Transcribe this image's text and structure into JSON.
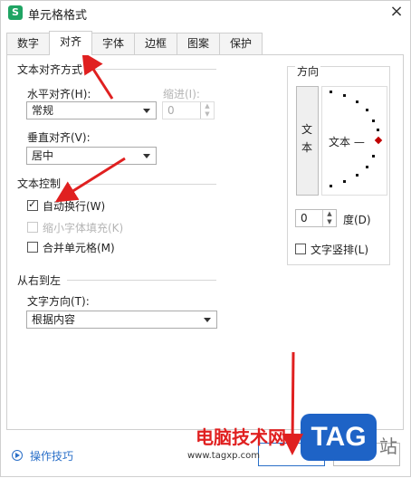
{
  "window": {
    "title": "单元格格式",
    "app_icon_letter": "S",
    "close_glyph": "×"
  },
  "tabs": [
    {
      "label": "数字",
      "active": false
    },
    {
      "label": "对齐",
      "active": true
    },
    {
      "label": "字体",
      "active": false
    },
    {
      "label": "边框",
      "active": false
    },
    {
      "label": "图案",
      "active": false
    },
    {
      "label": "保护",
      "active": false
    }
  ],
  "alignment": {
    "section_title": "文本对齐方式",
    "horizontal_label": "水平对齐(H):",
    "horizontal_value": "常规",
    "indent_label": "缩进(I):",
    "indent_value": "0",
    "vertical_label": "垂直对齐(V):",
    "vertical_value": "居中"
  },
  "text_control": {
    "section_title": "文本控制",
    "wrap_text": {
      "label": "自动换行(W)",
      "checked": true,
      "disabled": false
    },
    "shrink_to_fit": {
      "label": "缩小字体填充(K)",
      "checked": false,
      "disabled": true
    },
    "merge_cells": {
      "label": "合并单元格(M)",
      "checked": false,
      "disabled": false
    }
  },
  "rtl": {
    "section_title": "从右到左",
    "direction_label": "文字方向(T):",
    "direction_value": "根据内容"
  },
  "orientation": {
    "section_title": "方向",
    "vertical_text": [
      "文",
      "本"
    ],
    "dial_text": "文本 —",
    "degree_value": "0",
    "degree_label": "度(D)",
    "vertical_stack_label": "文字竖排(L)"
  },
  "footer": {
    "tips_link": "操作技巧"
  },
  "watermark": {
    "site_name": "电脑技术网",
    "url": "www.tagxp.com",
    "badge": "TAG",
    "suffix": "站"
  },
  "colors": {
    "annotation_arrow": "#e02020",
    "link": "#2a6fc8",
    "watermark_badge": "#1e63c6",
    "app_icon": "#1fa463"
  }
}
